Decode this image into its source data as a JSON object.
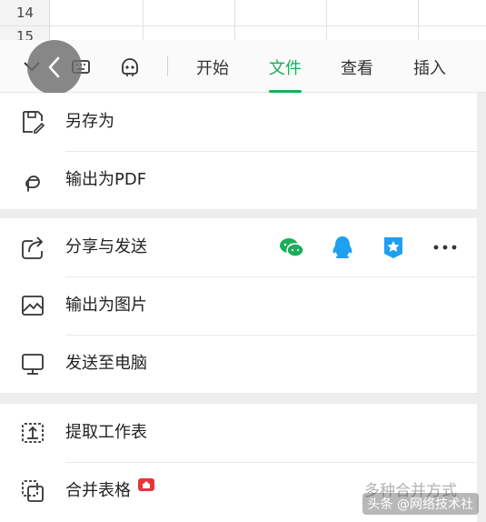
{
  "sheet": {
    "rows": [
      "14",
      "15"
    ]
  },
  "toolbar": {
    "tabs": [
      {
        "label": "开始",
        "active": false
      },
      {
        "label": "文件",
        "active": true
      },
      {
        "label": "查看",
        "active": false
      },
      {
        "label": "插入",
        "active": false
      }
    ]
  },
  "menu": {
    "save_as": "另存为",
    "export_pdf": "输出为PDF",
    "share_send": "分享与发送",
    "export_image": "输出为图片",
    "send_to_pc": "发送至电脑",
    "extract_sheet": "提取工作表",
    "merge_sheets": "合并表格",
    "merge_hint": "多种合并方式"
  },
  "share": {
    "icons": [
      "wechat-icon",
      "qq-icon",
      "tim-icon",
      "more-icon"
    ]
  },
  "colors": {
    "accent": "#1aad5a",
    "badge": "#e8353a",
    "qq": "#1ea0f1"
  },
  "watermark": "头条 @网络技术社"
}
